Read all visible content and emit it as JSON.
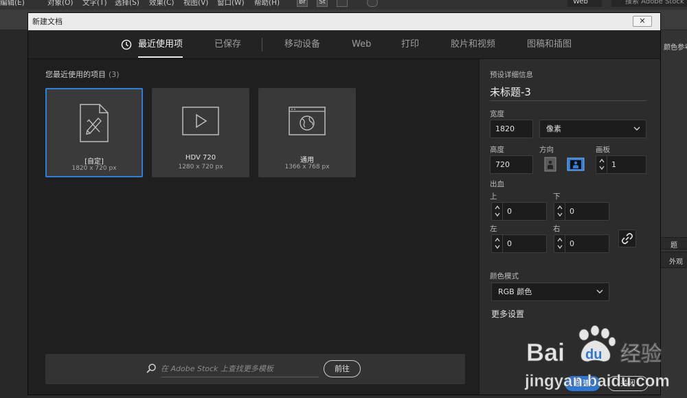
{
  "app": {
    "menus": [
      "编辑(E)",
      "对象(O)",
      "文字(T)",
      "选择(S)",
      "效果(C)",
      "视图(V)",
      "窗口(W)",
      "帮助(H)"
    ],
    "bridge_label": "Br",
    "stock_label": "St",
    "workspace": "Web",
    "search_placeholder": "搜索 Adobe Stock",
    "right_panel_labels": [
      "颜色参考",
      "题",
      "外观"
    ]
  },
  "dialog": {
    "title": "新建文档",
    "close_label": "✕",
    "tabs": [
      "最近使用项",
      "已保存",
      "移动设备",
      "Web",
      "打印",
      "胶片和视频",
      "图稿和插图"
    ],
    "active_tab": 0,
    "recent": {
      "heading": "您最近使用的项目",
      "count": "(3)",
      "items": [
        {
          "name": "[自定]",
          "size": "1820 x 720 px",
          "icon": "custom-document-icon"
        },
        {
          "name": "HDV 720",
          "size": "1280 x 720 px",
          "icon": "video-play-icon"
        },
        {
          "name": "通用",
          "size": "1366 x 768 px",
          "icon": "globe-browser-icon"
        }
      ]
    },
    "stock": {
      "placeholder": "在 Adobe Stock 上查找更多模板",
      "go_label": "前往"
    },
    "details": {
      "heading": "预设详细信息",
      "doc_name": "未标题-3",
      "width_label": "宽度",
      "width_value": "1820",
      "unit": "像素",
      "height_label": "高度",
      "height_value": "720",
      "orientation_label": "方向",
      "artboards_label": "画板",
      "artboards_value": "1",
      "bleed_label": "出血",
      "bleed_top_label": "上",
      "bleed_top": "0",
      "bleed_bottom_label": "下",
      "bleed_bottom": "0",
      "bleed_left_label": "左",
      "bleed_left": "0",
      "bleed_right_label": "右",
      "bleed_right": "0",
      "color_mode_label": "颜色模式",
      "color_mode": "RGB 颜色",
      "more_settings": "更多设置",
      "create_label": "创建",
      "close_label": "关闭"
    }
  },
  "watermark": {
    "brand": "Bai du 经验",
    "url": "jingyan.baidu.com"
  },
  "colors": {
    "accent": "#2f7fd8",
    "dialog_bg": "#242424",
    "panel_bg": "#2c2c2c"
  }
}
